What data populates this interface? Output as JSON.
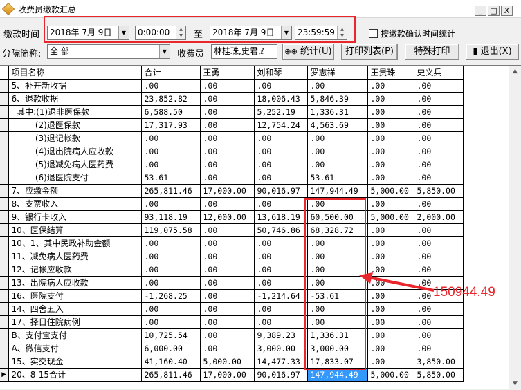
{
  "window": {
    "title": "收费员缴款汇总",
    "controls": [
      "_",
      "□",
      "X"
    ]
  },
  "filters": {
    "time_label": "缴款时间",
    "start_date": "2018年 7月 9日",
    "start_time": "0:00:00",
    "to_label": "至",
    "end_date": "2018年 7月 9日",
    "end_time": "23:59:59",
    "confirm_check_label": "按缴款确认时间统计",
    "branch_label": "分院简称:",
    "branch_value": "全 部",
    "cashier_label": "收费员",
    "cashier_value": "林桂珠,史君,ℓ"
  },
  "buttons": {
    "stats": "统计(U)",
    "print_list": "打印列表(P)",
    "special_print": "特殊打印",
    "exit": "退出(X)"
  },
  "table": {
    "columns": [
      "项目名称",
      "合计",
      "王勇",
      "刘和琴",
      "罗志祥",
      "王贵珠",
      "史义兵"
    ],
    "rows": [
      [
        "5、补开新收据",
        ".00",
        ".00",
        ".00",
        ".00",
        ".00",
        ".00"
      ],
      [
        "6、退款收据",
        "23,852.82",
        ".00",
        "18,006.43",
        "5,846.39",
        ".00",
        ".00"
      ],
      [
        "  其中:(1)退非医保款",
        "6,588.50",
        ".00",
        "5,252.19",
        "1,336.31",
        ".00",
        ".00"
      ],
      [
        "         (2)退医保款",
        "17,317.93",
        ".00",
        "12,754.24",
        "4,563.69",
        ".00",
        ".00"
      ],
      [
        "         (3)退记帐款",
        ".00",
        ".00",
        ".00",
        ".00",
        ".00",
        ".00"
      ],
      [
        "         (4)退出院病人应收款",
        ".00",
        ".00",
        ".00",
        ".00",
        ".00",
        ".00"
      ],
      [
        "         (5)退减免病人医药费",
        ".00",
        ".00",
        ".00",
        ".00",
        ".00",
        ".00"
      ],
      [
        "         (6)退医院支付",
        "53.61",
        ".00",
        ".00",
        "53.61",
        ".00",
        ".00"
      ],
      [
        "7、应缴金额",
        "265,811.46",
        "17,000.00",
        "90,016.97",
        "147,944.49",
        "5,000.00",
        "5,850.00"
      ],
      [
        "8、支票收入",
        ".00",
        ".00",
        ".00",
        ".00",
        ".00",
        ".00"
      ],
      [
        "9、银行卡收入",
        "93,118.19",
        "12,000.00",
        "13,618.19",
        "60,500.00",
        "5,000.00",
        "2,000.00"
      ],
      [
        "10、医保结算",
        "119,075.58",
        ".00",
        "50,746.86",
        "68,328.72",
        ".00",
        ".00"
      ],
      [
        "10、1、其中民政补助金额",
        ".00",
        ".00",
        ".00",
        ".00",
        ".00",
        ".00"
      ],
      [
        "11、减免病人医药费",
        ".00",
        ".00",
        ".00",
        ".00",
        ".00",
        ".00"
      ],
      [
        "12、记帐应收款",
        ".00",
        ".00",
        ".00",
        ".00",
        ".00",
        ".00"
      ],
      [
        "13、出院病人应收款",
        ".00",
        ".00",
        ".00",
        ".00",
        ".00",
        ".00"
      ],
      [
        "16、医院支付",
        "-1,268.25",
        ".00",
        "-1,214.64",
        "-53.61",
        ".00",
        ".00"
      ],
      [
        "14、四舍五入",
        ".00",
        ".00",
        ".00",
        ".00",
        ".00",
        ".00"
      ],
      [
        "17、择日住院病例",
        ".00",
        ".00",
        ".00",
        ".00",
        ".00",
        ".00"
      ],
      [
        "B、支付宝支付",
        "10,725.54",
        ".00",
        "9,389.23",
        "1,336.31",
        ".00",
        ".00"
      ],
      [
        "A、微信支付",
        "6,000.00",
        ".00",
        "3,000.00",
        "3,000.00",
        ".00",
        ".00"
      ],
      [
        "15、实交现金",
        "41,160.40",
        "5,000.00",
        "14,477.33",
        "17,833.07",
        ".00",
        "3,850.00"
      ],
      [
        "20、8-15合计",
        "265,811.46",
        "17,000.00",
        "90,016.97",
        "147,944.49",
        "5,000.00",
        "5,850.00"
      ]
    ],
    "current_row_marker": "▶"
  },
  "annotation": {
    "text": "150944.49",
    "color": "#e8262c"
  },
  "colors": {
    "selection": "#3399ff",
    "highlight_box": "#e8262c"
  }
}
